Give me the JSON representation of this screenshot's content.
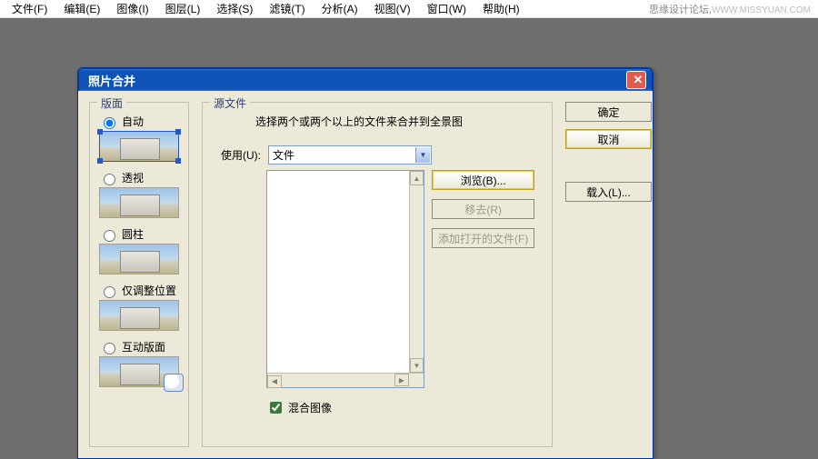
{
  "menu": {
    "file": "文件(F)",
    "edit": "编辑(E)",
    "image": "图像(I)",
    "layer": "图层(L)",
    "select": "选择(S)",
    "filter": "滤镜(T)",
    "analysis": "分析(A)",
    "view": "视图(V)",
    "window": "窗口(W)",
    "help": "帮助(H)"
  },
  "watermark": {
    "text": "思缘设计论坛,",
    "url": "WWW.MISSYUAN.COM"
  },
  "dialog": {
    "title": "照片合并",
    "layout": {
      "legend": "版面",
      "auto": "自动",
      "perspective": "透视",
      "cylinder": "圆柱",
      "reposition": "仅调整位置",
      "interactive": "互动版面"
    },
    "source": {
      "legend": "源文件",
      "desc": "选择两个或两个以上的文件来合并到全景图",
      "use_label": "使用(U):",
      "use_value": "文件",
      "browse": "浏览(B)...",
      "remove": "移去(R)",
      "add_open": "添加打开的文件(F)",
      "blend": "混合图像"
    },
    "buttons": {
      "ok": "确定",
      "cancel": "取消",
      "load": "载入(L)..."
    }
  }
}
